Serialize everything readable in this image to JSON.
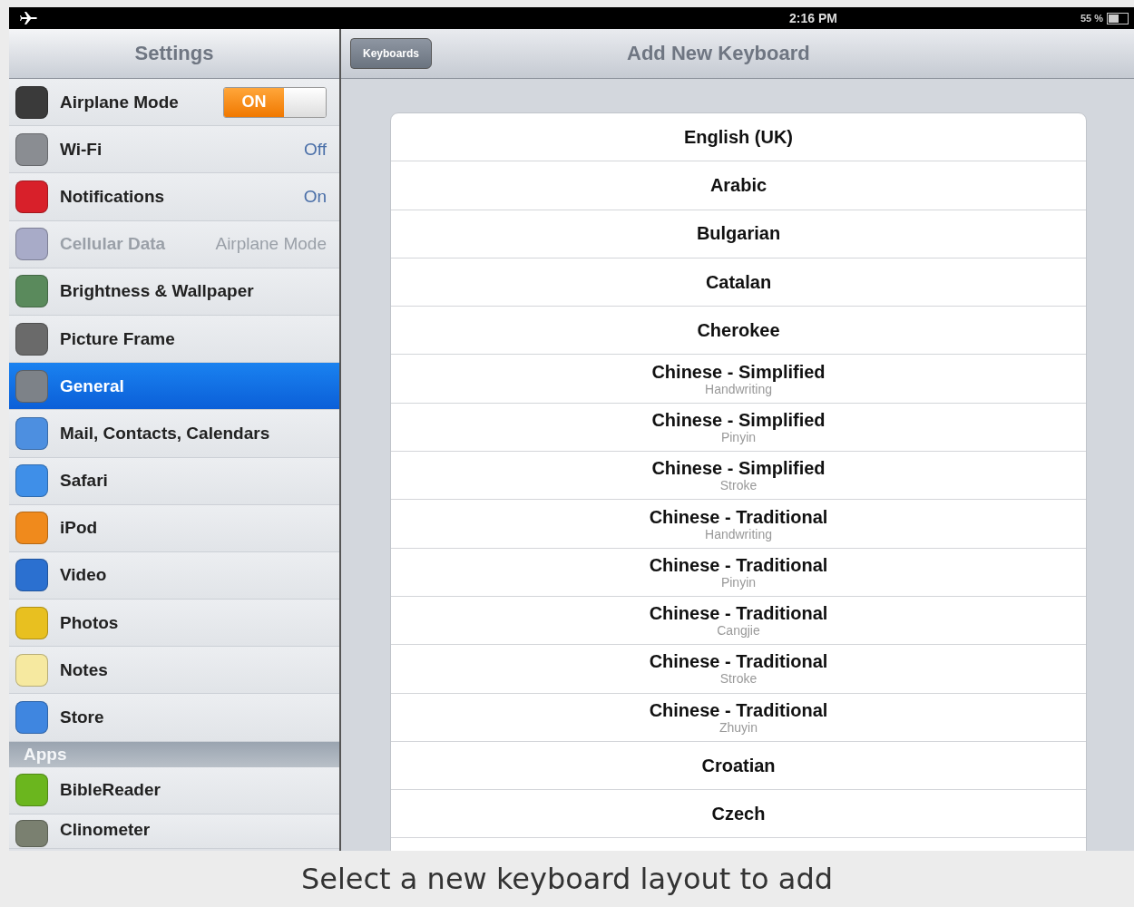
{
  "status_bar": {
    "time": "2:16 PM",
    "battery": "55 %"
  },
  "sidebar": {
    "title": "Settings",
    "items": [
      {
        "label": "Airplane Mode",
        "kind": "toggle",
        "toggle": {
          "label": "ON",
          "on": true
        },
        "color": "#3a3a3a",
        "selected": false,
        "disabled": false
      },
      {
        "label": "Wi-Fi",
        "kind": "value",
        "value": "Off",
        "color": "#8a8d92",
        "selected": false,
        "disabled": false
      },
      {
        "label": "Notifications",
        "kind": "value",
        "value": "On",
        "color": "#d8202a",
        "selected": false,
        "disabled": false
      },
      {
        "label": "Cellular Data",
        "kind": "value",
        "value": "Airplane Mode",
        "color": "#a8abc8",
        "selected": false,
        "disabled": true
      },
      {
        "label": "Brightness & Wallpaper",
        "kind": "plain",
        "color": "#5a8a5c",
        "selected": false,
        "disabled": false
      },
      {
        "label": "Picture Frame",
        "kind": "plain",
        "color": "#6a6a6a",
        "selected": false,
        "disabled": false
      },
      {
        "label": "General",
        "kind": "plain",
        "color": "#7d8288",
        "selected": true,
        "disabled": false
      },
      {
        "label": "Mail, Contacts, Calendars",
        "kind": "plain",
        "color": "#4d8fe0",
        "selected": false,
        "disabled": false
      },
      {
        "label": "Safari",
        "kind": "plain",
        "color": "#3f8fe8",
        "selected": false,
        "disabled": false
      },
      {
        "label": "iPod",
        "kind": "plain",
        "color": "#f08a1c",
        "selected": false,
        "disabled": false
      },
      {
        "label": "Video",
        "kind": "plain",
        "color": "#2b70d0",
        "selected": false,
        "disabled": false
      },
      {
        "label": "Photos",
        "kind": "plain",
        "color": "#e8c020",
        "selected": false,
        "disabled": false
      },
      {
        "label": "Notes",
        "kind": "plain",
        "color": "#f6e9a0",
        "selected": false,
        "disabled": false
      },
      {
        "label": "Store",
        "kind": "plain",
        "color": "#3f86e0",
        "selected": false,
        "disabled": false
      }
    ],
    "section": "Apps",
    "apps": [
      {
        "label": "BibleReader",
        "color": "#6bb61e",
        "selected": false
      },
      {
        "label": "Clinometer",
        "color": "#7a8070",
        "selected": false
      }
    ]
  },
  "nav": {
    "back": "Keyboards",
    "title": "Add New Keyboard"
  },
  "keyboards": [
    {
      "name": "English (UK)"
    },
    {
      "name": "Arabic"
    },
    {
      "name": "Bulgarian"
    },
    {
      "name": "Catalan"
    },
    {
      "name": "Cherokee"
    },
    {
      "name": "Chinese - Simplified",
      "detail": "Handwriting"
    },
    {
      "name": "Chinese - Simplified",
      "detail": "Pinyin"
    },
    {
      "name": "Chinese - Simplified",
      "detail": "Stroke"
    },
    {
      "name": "Chinese - Traditional",
      "detail": "Handwriting"
    },
    {
      "name": "Chinese - Traditional",
      "detail": "Pinyin"
    },
    {
      "name": "Chinese - Traditional",
      "detail": "Cangjie"
    },
    {
      "name": "Chinese - Traditional",
      "detail": "Stroke"
    },
    {
      "name": "Chinese - Traditional",
      "detail": "Zhuyin"
    },
    {
      "name": "Croatian"
    },
    {
      "name": "Czech"
    }
  ],
  "caption": "Select a new keyboard layout to add"
}
